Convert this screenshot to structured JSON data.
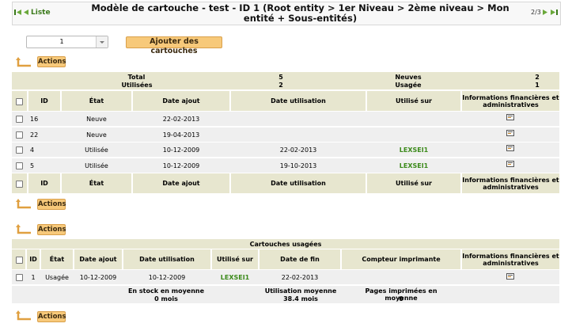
{
  "header": {
    "list_label": "Liste",
    "title": "Modèle de cartouche - test - ID 1 (Root entity > 1er Niveau > 2ème niveau > Mon entité + Sous-entités)",
    "page": "2/3"
  },
  "controls": {
    "quantity_value": "1",
    "add_button": "Ajouter des cartouches"
  },
  "actions_label": "Actions",
  "summary": {
    "total_label": "Total",
    "total_value": "5",
    "used_label": "Utilisées",
    "used_value": "2",
    "new_label": "Neuves",
    "new_value": "2",
    "worn_label": "Usagée",
    "worn_value": "1"
  },
  "table1": {
    "columns": [
      "ID",
      "État",
      "Date ajout",
      "Date utilisation",
      "Utilisé sur",
      "Informations financières et administratives"
    ],
    "rows": [
      {
        "id": "16",
        "state": "Neuve",
        "added": "22-02-2013",
        "used_date": "",
        "used_on": ""
      },
      {
        "id": "22",
        "state": "Neuve",
        "added": "19-04-2013",
        "used_date": "",
        "used_on": ""
      },
      {
        "id": "4",
        "state": "Utilisée",
        "added": "10-12-2009",
        "used_date": "22-02-2013",
        "used_on": "LEXSEI1"
      },
      {
        "id": "5",
        "state": "Utilisée",
        "added": "10-12-2009",
        "used_date": "19-10-2013",
        "used_on": "LEXSEI1"
      }
    ]
  },
  "table2": {
    "title": "Cartouches usagées",
    "columns": [
      "ID",
      "État",
      "Date ajout",
      "Date utilisation",
      "Utilisé sur",
      "Date de fin",
      "Compteur imprimante",
      "Informations financières et administratives"
    ],
    "rows": [
      {
        "id": "1",
        "state": "Usagée",
        "added": "10-12-2009",
        "used_date": "10-12-2009",
        "used_on": "LEXSEI1",
        "end_date": "22-02-2013",
        "counter": ""
      }
    ],
    "stats": {
      "stock_label": "En stock en moyenne",
      "stock_value": "0 mois",
      "usage_label": "Utilisation moyenne",
      "usage_value": "38.4 mois",
      "pages_label": "Pages imprimées en moyenne",
      "pages_value": "0"
    }
  },
  "icons": [
    "first-page-icon",
    "prev-page-icon",
    "next-page-icon",
    "last-page-icon",
    "return-arrow-icon",
    "financial-info-icon"
  ],
  "colors": {
    "accent_button": "#f7c97a",
    "header_row": "#e7e6cf",
    "row": "#efefef",
    "link_green": "#3b8a1a"
  }
}
